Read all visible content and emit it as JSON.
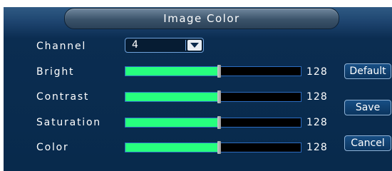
{
  "title": "Image Color",
  "channel": {
    "label": "Channel",
    "value": "4"
  },
  "sliders": [
    {
      "label": "Bright",
      "value": "128",
      "fraction": 0.53
    },
    {
      "label": "Contrast",
      "value": "128",
      "fraction": 0.53
    },
    {
      "label": "Saturation",
      "value": "128",
      "fraction": 0.53
    },
    {
      "label": "Color",
      "value": "128",
      "fraction": 0.53
    }
  ],
  "buttons": {
    "default": "Default",
    "save": "Save",
    "cancel": "Cancel"
  },
  "colors": {
    "slider_fill": "#27ff7e",
    "panel_bg": "#0b2d51"
  }
}
